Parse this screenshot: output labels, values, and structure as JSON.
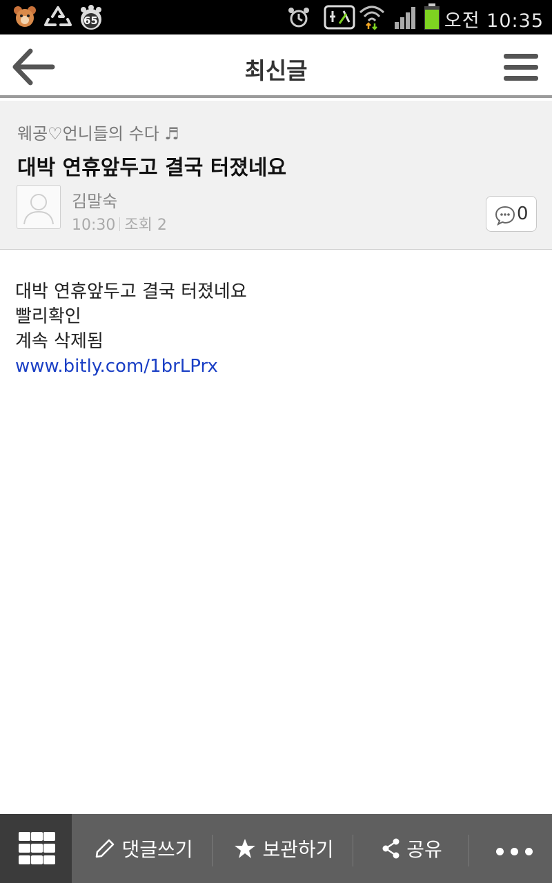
{
  "status_bar": {
    "time": "오전 10:35",
    "badge_number": "65",
    "battery_color": "#7ed321"
  },
  "header": {
    "title": "최신글"
  },
  "post": {
    "board_name": "웨공♡언니들의 수다 ♬",
    "title": "대박 연휴앞두고 결국 터졌네요",
    "author": "김말숙",
    "time": "10:30",
    "views_label": "조회 2",
    "comment_count": "0",
    "body_lines": [
      "대박 연휴앞두고 결국 터졌네요",
      "빨리확인",
      "계속 삭제됨"
    ],
    "link": "www.bitly.com/1brLPrx"
  },
  "bottom_bar": {
    "write_comment": "댓글쓰기",
    "bookmark": "보관하기",
    "share": "공유"
  },
  "colors": {
    "link": "#1a3fc5",
    "bottom_bar": "#5f5f5f",
    "grid_button": "#3b3b3b"
  }
}
